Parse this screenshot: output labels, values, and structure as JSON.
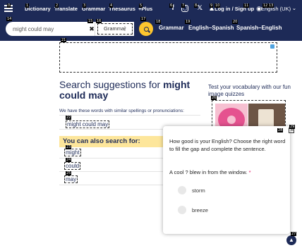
{
  "nav": {
    "items": [
      {
        "label": "Dictionary"
      },
      {
        "label": "Translate"
      },
      {
        "label": "Grammar"
      },
      {
        "label": "Thesaurus"
      },
      {
        "label": "+Plus"
      }
    ],
    "login_label": "Log in / Sign up",
    "language_label": "English (UK)"
  },
  "search": {
    "value": "might could may",
    "dictionary_label": "Grammar",
    "quick_links": [
      "Grammar",
      "English–Spanish",
      "Spanish–English"
    ]
  },
  "main": {
    "heading_prefix": "Search suggestions for ",
    "heading_term": "might could may",
    "description": "We have these words with similar spellings or pronunciations:",
    "suggestion": "might could may",
    "also_title": "You can also search for:",
    "also_links": [
      "might",
      "could",
      "may"
    ]
  },
  "quiz_panel": {
    "title": "Test your vocabulary with our fun image quizzes"
  },
  "popup": {
    "question": "How good is your English? Choose the right word to fill the gap and complete the sentence.",
    "sentence": "A cool ? blew in from the window.",
    "required_mark": "*",
    "options": [
      "storm",
      "breeze"
    ]
  },
  "badges": [
    "0",
    "1",
    "2",
    "3",
    "4",
    "5",
    "6",
    "7",
    "8",
    "9",
    "10",
    "11",
    "12",
    "13",
    "14",
    "15",
    "16",
    "17",
    "18",
    "19",
    "20",
    "21",
    "22",
    "23",
    "24",
    "25",
    "26",
    "27",
    "28",
    "29"
  ],
  "colors": {
    "nav_bg": "#1d2a57",
    "accent_yellow": "#fec62e",
    "highlight_bg": "#fde69b"
  }
}
